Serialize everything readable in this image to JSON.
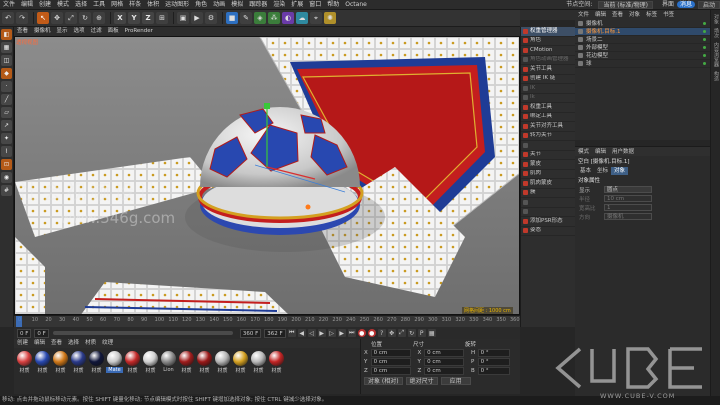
{
  "menubar": {
    "items": [
      "文件",
      "编辑",
      "创建",
      "模式",
      "选择",
      "工具",
      "网格",
      "样条",
      "体积",
      "运动图形",
      "角色",
      "动画",
      "模拟",
      "跟踪器",
      "渲染",
      "扩展",
      "窗口",
      "帮助",
      "Octane"
    ],
    "layout_label": "节点空间:",
    "layout_value": "当前 (标准/物理)",
    "layout2_label": "界面",
    "layout2_value": "启动",
    "badge": "消息"
  },
  "toolbar": {
    "axis_x": "X",
    "axis_y": "Y",
    "axis_z": "Z"
  },
  "viewport": {
    "menu": [
      "查看",
      "摄像机",
      "显示",
      "选项",
      "过滤",
      "面板",
      "ProRender"
    ],
    "label": "透视视图",
    "grid_status": "网格间距 : 1000 cm"
  },
  "plugin_panel": {
    "items": [
      {
        "label": "权重管理器",
        "state": "head"
      },
      {
        "label": "角色",
        "state": "on"
      },
      {
        "label": "CMotion",
        "state": "on"
      },
      {
        "label": "角色动画管理器",
        "state": "dis"
      },
      {
        "label": "关节工具",
        "state": "on"
      },
      {
        "label": "创建 IK 链",
        "state": "on"
      },
      {
        "label": "IK",
        "state": "dis"
      },
      {
        "label": "Ik",
        "state": "dis"
      },
      {
        "label": "权重工具",
        "state": "on"
      },
      {
        "label": "绑定工具",
        "state": "on"
      },
      {
        "label": "关节对齐工具",
        "state": "on"
      },
      {
        "label": "转为关节",
        "state": "on"
      },
      {
        "label": "",
        "state": "dis"
      },
      {
        "label": "关节",
        "state": "on"
      },
      {
        "label": "蒙皮",
        "state": "on"
      },
      {
        "label": "肌肉",
        "state": "on"
      },
      {
        "label": "肌肉蒙皮",
        "state": "on"
      },
      {
        "label": "簇",
        "state": "on"
      },
      {
        "label": "",
        "state": "dis"
      },
      {
        "label": "",
        "state": "dis"
      },
      {
        "label": "添加PSR形态",
        "state": "on"
      },
      {
        "label": "姿态",
        "state": "on"
      }
    ]
  },
  "object_manager": {
    "menu": [
      "文件",
      "编辑",
      "查看",
      "对象",
      "标签",
      "书签"
    ],
    "rows": [
      {
        "label": "摄像机",
        "selected": false
      },
      {
        "label": "摄像机.目标.1",
        "selected": true
      },
      {
        "label": "场景二",
        "selected": false
      },
      {
        "label": "外部模型",
        "selected": false
      },
      {
        "label": "花边模型",
        "selected": false
      },
      {
        "label": "球",
        "selected": false
      }
    ]
  },
  "attributes": {
    "menu": [
      "模式",
      "编辑",
      "用户数据"
    ],
    "title": "空白 [摄像机.目标.1]",
    "tabs": [
      "基本",
      "坐标",
      "对象"
    ],
    "active_tab": "对象",
    "section": "对象属性",
    "rows": [
      {
        "label": "显示",
        "value": "圆点",
        "dim": false
      },
      {
        "label": "半径",
        "value": "10 cm",
        "dim": true
      },
      {
        "label": "宽高比",
        "value": "1",
        "dim": true
      },
      {
        "label": "方向",
        "value": "摄像机",
        "dim": true
      }
    ]
  },
  "right_strip": {
    "labels": [
      "对象",
      "场次",
      "内容浏览器",
      "构造"
    ]
  },
  "timeline": {
    "ticks": [
      "0",
      "10",
      "20",
      "30",
      "40",
      "50",
      "60",
      "70",
      "80",
      "90",
      "100",
      "110",
      "120",
      "130",
      "140",
      "150",
      "160",
      "170",
      "180",
      "190",
      "200",
      "210",
      "220",
      "230",
      "240",
      "250",
      "260",
      "270",
      "280",
      "290",
      "300",
      "310",
      "320",
      "330",
      "340",
      "350",
      "360"
    ],
    "current_frame": "0 F",
    "start_field": "0 F",
    "end_field": "360 F",
    "end_field2": "362 F"
  },
  "materials": {
    "menu": [
      "创建",
      "编辑",
      "查看",
      "选择",
      "材质",
      "纹理"
    ],
    "items": [
      {
        "label": "材质",
        "color": "#d84040",
        "selected": false
      },
      {
        "label": "材质",
        "color": "#2848b0",
        "selected": false
      },
      {
        "label": "材质",
        "color": "#d07818",
        "selected": false
      },
      {
        "label": "材质",
        "color": "#2a3a8a",
        "selected": false
      },
      {
        "label": "材质",
        "color": "#10163a",
        "selected": false
      },
      {
        "label": "Mate",
        "color": "#c9c9c9",
        "selected": true
      },
      {
        "label": "材质",
        "color": "#c42828",
        "selected": false
      },
      {
        "label": "材质",
        "color": "#d0d0d0",
        "selected": false
      },
      {
        "label": "Lion",
        "color": "#8a8a8a",
        "selected": false
      },
      {
        "label": "材质",
        "color": "#a01c1c",
        "selected": false
      },
      {
        "label": "材质",
        "color": "#9a1818",
        "selected": false
      },
      {
        "label": "材质",
        "color": "#b4b4b4",
        "selected": false
      },
      {
        "label": "材质",
        "color": "#d4a020",
        "selected": false
      },
      {
        "label": "材质",
        "color": "#b8b8b8",
        "selected": false
      },
      {
        "label": "材质",
        "color": "#c22424",
        "selected": false
      }
    ]
  },
  "coordinates": {
    "headers": [
      "位置",
      "尺寸",
      "旋转"
    ],
    "rows": [
      {
        "axis": "X",
        "pos": "0 cm",
        "size": "0 cm",
        "rot_axis": "H",
        "rot": "0 °"
      },
      {
        "axis": "Y",
        "pos": "0 cm",
        "size": "0 cm",
        "rot_axis": "P",
        "rot": "0 °"
      },
      {
        "axis": "Z",
        "pos": "0 cm",
        "size": "0 cm",
        "rot_axis": "B",
        "rot": "0 °"
      }
    ],
    "mode_dropdown": "对象 (相对)",
    "size_dropdown": "绝对尺寸",
    "apply_button": "应用"
  },
  "status_bar": "移动: 点击并拖动鼠标移动元素。按住 SHIFT 键量化移动; 节点编辑模式时按住 SHIFT 键增加选择对象; 按住 CTRL 键减少选择对象。",
  "watermarks": {
    "cn": "社会视频设计",
    "url": "www.546g.com",
    "brand_url": "WWW.CUBE-V.COM"
  }
}
